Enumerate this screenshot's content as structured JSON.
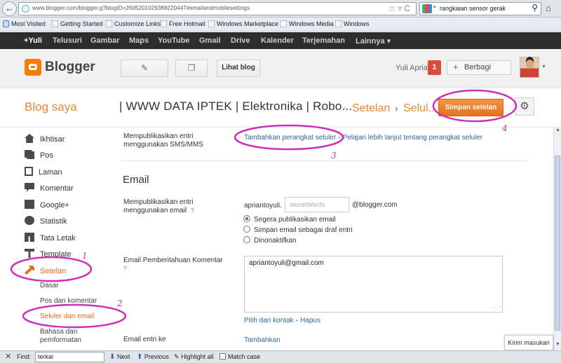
{
  "browser": {
    "url": "www.blogger.com/blogger.g?blogID=2605201029388220447#emailandmobilesettings",
    "search_query": "rangkaian sensor gerak",
    "bookmarks": [
      "Most Visited",
      "Getting Started",
      "Customize Links",
      "Free Hotmail",
      "Windows Marketplace",
      "Windows Media",
      "Windows"
    ]
  },
  "gbar": [
    "+Yuli",
    "Telusuri",
    "Gambar",
    "Maps",
    "YouTube",
    "Gmail",
    "Drive",
    "Kalender",
    "Terjemahan",
    "Lainnya ▾"
  ],
  "header": {
    "logo": "Blogger",
    "view_blog": "Lihat blog",
    "user": "Yuli Aprianto",
    "notifications": "1",
    "share": "Berbagi"
  },
  "titlebar": {
    "blog_saya": "Blog saya",
    "blog_title": "| WWW DATA IPTEK | Elektronika | Robo...",
    "crumb_dot": "·",
    "crumb_setelan": "Setelan",
    "crumb_sep": "›",
    "crumb_seluler": "Selul...",
    "save_label": "Simpan setelan"
  },
  "sidebar": {
    "items": [
      {
        "label": "Ikhtisar",
        "icon": "home-icon"
      },
      {
        "label": "Pos",
        "icon": "posts-icon"
      },
      {
        "label": "Laman",
        "icon": "pages-icon"
      },
      {
        "label": "Komentar",
        "icon": "comment-icon"
      },
      {
        "label": "Google+",
        "icon": "google-plus-icon"
      },
      {
        "label": "Statistik",
        "icon": "stats-icon"
      },
      {
        "label": "Tata Letak",
        "icon": "layout-icon"
      },
      {
        "label": "Template",
        "icon": "template-icon"
      },
      {
        "label": "Setelan",
        "icon": "wrench-icon"
      }
    ],
    "subitems": [
      "Dasar",
      "Pos dan komentar",
      "Seluler dan email",
      "Bahasa dan",
      "pemformatan"
    ]
  },
  "main": {
    "sms_label_1": "Mempublikasikan entri",
    "sms_label_2": "menggunakan SMS/MMS",
    "add_device_link": "Tambahkan perangkat seluler",
    "link_separator": "-",
    "learn_more_link": "Pelajari lebih lanjut tentang perangkat seluler",
    "section_email": "Email",
    "email_label_1": "Mempublikasikan entri",
    "email_label_2": "menggunakan email",
    "help": "?",
    "email_prefix": "apriantoyuli.",
    "secret_placeholder": "secretWords",
    "email_domain": "@blogger.com",
    "radio_options": [
      "Segera publikasikan email",
      "Simpan email sebagai draf entri",
      "Dinonaktifkan"
    ],
    "comment_label": "Email Pemberitahuan Komentar",
    "comment_email": "apriantoyuli@gmail.com",
    "pick_contact": "Pilih dari kontak",
    "delete": "Hapus",
    "entry_email_label": "Email entri ke",
    "add": "Tambahkan",
    "feedback": "Kirim masukan"
  },
  "findbar": {
    "close": "✕",
    "label": "Find:",
    "value": "terkai",
    "next": "Next",
    "previous": "Previous",
    "highlight": "Highlight all",
    "match_case": "Match case"
  },
  "annotations": [
    "1",
    "2",
    "3",
    "4"
  ],
  "colors": {
    "accent": "#e98a32",
    "annotation": "#d02fb8",
    "link": "#2a6a9e"
  }
}
